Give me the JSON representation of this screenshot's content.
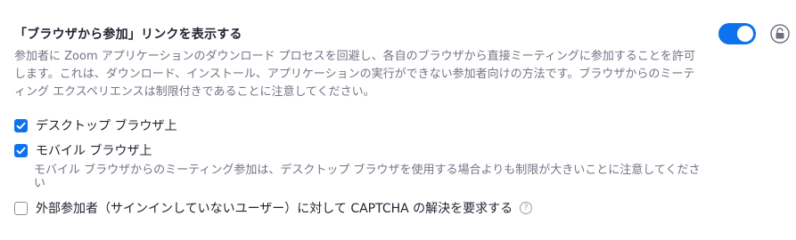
{
  "setting": {
    "title": "「ブラウザから参加」リンクを表示する",
    "description": "参加者に Zoom アプリケーションのダウンロード プロセスを回避し、各自のブラウザから直接ミーティングに参加することを許可します。これは、ダウンロード、インストール、アプリケーションの実行ができない参加者向けの方法です。ブラウザからのミーティング エクスペリエンスは制限付きであることに注意してください。",
    "enabled": true,
    "locked": false
  },
  "options": [
    {
      "label": "デスクトップ ブラウザ上",
      "checked": true
    },
    {
      "label": "モバイル ブラウザ上",
      "checked": true
    },
    {
      "label": "外部参加者（サインインしていないユーザー）に対して CAPTCHA の解決を要求する",
      "checked": false
    }
  ],
  "mobile_note": "モバイル ブラウザからのミーティング参加は、デスクトップ ブラウザを使用する場合よりも制限が大きいことに注意してください",
  "icons": {
    "toggle": "toggle-switch",
    "lock": "lock-icon",
    "help": "question-mark-icon",
    "check": "check-icon"
  },
  "colors": {
    "accent": "#0e72ed",
    "text": "#232333",
    "muted": "#747487"
  }
}
